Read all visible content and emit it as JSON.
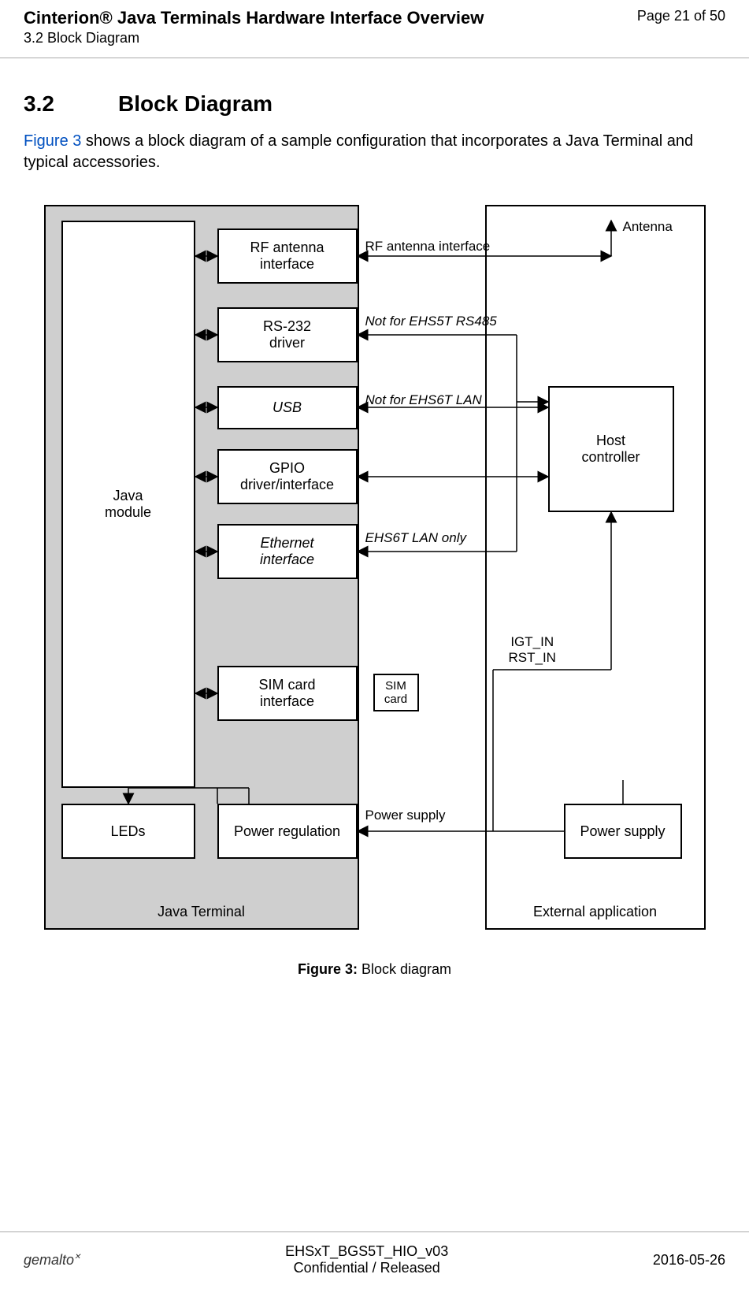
{
  "header": {
    "doc_title": "Cinterion® Java Terminals Hardware Interface Overview",
    "section_crumb": "3.2 Block Diagram",
    "page_of": "Page 21 of 50"
  },
  "section": {
    "number": "3.2",
    "title": "Block Diagram",
    "intro_link": "Figure 3",
    "intro_rest": " shows a block diagram of a sample configuration that incorporates a Java Terminal and typical accessories."
  },
  "diagram": {
    "terminal_label": "Java Terminal",
    "external_label": "External application",
    "java_module": "Java\nmodule",
    "rf_antenna_if": "RF antenna\ninterface",
    "rs232_driver": "RS-232\ndriver",
    "usb": "USB",
    "gpio": "GPIO\ndriver/interface",
    "ethernet_if": "Ethernet\ninterface",
    "sim_if": "SIM card\ninterface",
    "sim_card": "SIM\ncard",
    "leds": "LEDs",
    "power_reg": "Power regulation",
    "host_ctl": "Host\ncontroller",
    "power_supply": "Power supply",
    "antenna": "Antenna",
    "conn_rf": "RF antenna interface",
    "conn_rs232": "Not for EHS5T RS485",
    "conn_usb": "Not for EHS6T LAN",
    "conn_eth": "EHS6T LAN only",
    "conn_igt": "IGT_IN\nRST_IN",
    "conn_power": "Power supply"
  },
  "fig_caption_bold": "Figure 3:",
  "fig_caption_rest": "  Block diagram",
  "footer": {
    "logo": "gemalto",
    "mid_line1": "EHSxT_BGS5T_HIO_v03",
    "mid_line2": "Confidential / Released",
    "date": "2016-05-26"
  }
}
